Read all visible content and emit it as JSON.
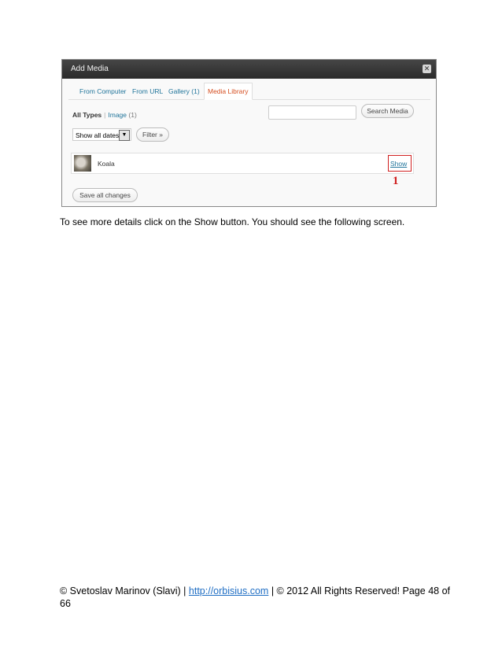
{
  "screenshot": {
    "title": "Add Media",
    "close_icon": "close-icon",
    "tabs": [
      {
        "label": "From Computer",
        "active": false
      },
      {
        "label": "From URL",
        "active": false
      },
      {
        "label": "Gallery (1)",
        "active": false
      },
      {
        "label": "Media Library",
        "active": true
      }
    ],
    "types": {
      "all_label": "All Types",
      "separator": "|",
      "image_label": "Image",
      "image_count": "(1)"
    },
    "search": {
      "placeholder": "",
      "button_label": "Search Media"
    },
    "dates_select": {
      "value": "Show all dates",
      "icon": "chevron-down-icon"
    },
    "filter_label": "Filter »",
    "item": {
      "name": "Koala",
      "show_label": "Show",
      "marker": "1"
    },
    "save_label": "Save all changes"
  },
  "body_text": "To see more details click on the Show button. You should see the following screen.",
  "footer": {
    "prefix": "© Svetoslav Marinov (Slavi) | ",
    "link": "http://orbisius.com",
    "suffix": " | © 2012 All Rights Reserved! Page 48 of 66"
  },
  "colors": {
    "link": "#21759b",
    "active_tab": "#d54e21",
    "annotation": "#d02020"
  }
}
